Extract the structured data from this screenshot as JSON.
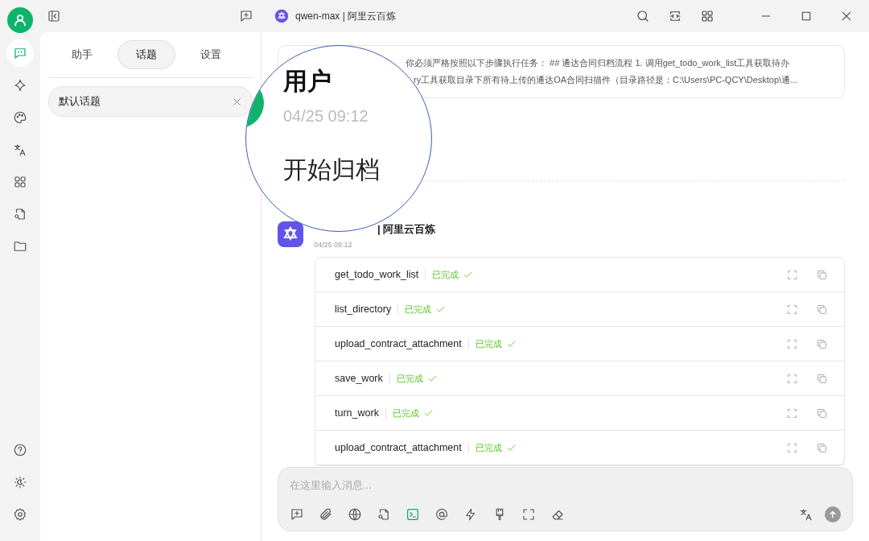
{
  "rail_items": [
    {
      "kind": "chat",
      "selected": true
    },
    {
      "kind": "sparkle",
      "selected": false
    },
    {
      "kind": "palette",
      "selected": false
    },
    {
      "kind": "translate",
      "selected": false
    },
    {
      "kind": "apps",
      "selected": false
    },
    {
      "kind": "docsearch",
      "selected": false
    },
    {
      "kind": "folder",
      "selected": false
    }
  ],
  "rail_bottom": [
    {
      "kind": "help"
    },
    {
      "kind": "theme"
    },
    {
      "kind": "settings"
    }
  ],
  "title_bar": {
    "model": "qwen-max | 阿里云百炼"
  },
  "sidebar_tabs": [
    {
      "label": "助手",
      "selected": false
    },
    {
      "label": "话题",
      "selected": true
    },
    {
      "label": "设置",
      "selected": false
    }
  ],
  "topics": [
    {
      "title": "默认话题",
      "selected": true
    }
  ],
  "system_prompt": {
    "lines": [
      "你必须严格按照以下步骤执行任务： ## 通达合同归档流程 1. 调用get_todo_work_list工具获取待办",
      "ry工具获取目录下所有待上传的通达OA合同扫描件（目录路径是：C:\\Users\\PC-QCY\\Desktop\\通..."
    ]
  },
  "magnifier": {
    "name": "用户",
    "time": "04/25 09:12",
    "text": "开始归档"
  },
  "assistant": {
    "name": "| 阿里云百炼",
    "time": "04/25 09:12",
    "tools": [
      {
        "name": "get_todo_work_list",
        "status": "已完成",
        "done": true
      },
      {
        "name": "list_directory",
        "status": "已完成",
        "done": true
      },
      {
        "name": "upload_contract_attachment",
        "status": "已完成",
        "done": true
      },
      {
        "name": "save_work",
        "status": "已完成",
        "done": true
      },
      {
        "name": "turn_work",
        "status": "已完成",
        "done": true
      },
      {
        "name": "upload_contract_attachment",
        "status": "已完成",
        "done": true
      }
    ]
  },
  "composer": {
    "placeholder": "在这里输入消息...",
    "tools": [
      {
        "kind": "newtopic",
        "selected": false
      },
      {
        "kind": "attach",
        "selected": false
      },
      {
        "kind": "web",
        "selected": false
      },
      {
        "kind": "docsearch",
        "selected": false
      },
      {
        "kind": "terminal",
        "selected": true
      },
      {
        "kind": "mention",
        "selected": false
      },
      {
        "kind": "bolt",
        "selected": false
      },
      {
        "kind": "brush",
        "selected": false
      },
      {
        "kind": "expand",
        "selected": false
      },
      {
        "kind": "eraser",
        "selected": false
      }
    ]
  }
}
